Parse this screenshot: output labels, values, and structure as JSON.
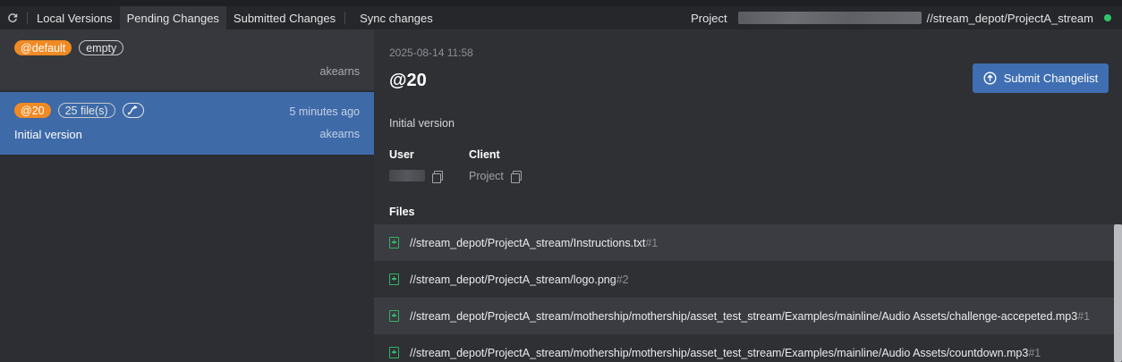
{
  "tabs": {
    "local": "Local Versions",
    "pending": "Pending Changes",
    "submitted": "Submitted Changes",
    "sync": "Sync changes"
  },
  "header": {
    "project_label": "Project",
    "stream": "//stream_depot/ProjectA_stream",
    "status_color": "#30c46b"
  },
  "changelists": [
    {
      "badge": "@default",
      "count_badge": "empty",
      "user": "akearns"
    },
    {
      "badge": "@20",
      "count_badge": "25 file(s)",
      "time": "5 minutes ago",
      "description": "Initial version",
      "user": "akearns",
      "selected": true
    }
  ],
  "detail": {
    "date": "2025-08-14 11:58",
    "title": "@20",
    "submit_label": "Submit Changelist",
    "description": "Initial version",
    "user_header": "User",
    "client_header": "Client",
    "client_value": "Project",
    "files_header": "Files",
    "files": [
      {
        "path": "//stream_depot/ProjectA_stream/Instructions.txt",
        "rev": "#1"
      },
      {
        "path": "//stream_depot/ProjectA_stream/logo.png",
        "rev": "#2"
      },
      {
        "path": "//stream_depot/ProjectA_stream/mothership/mothership/asset_test_stream/Examples/mainline/Audio Assets/challenge-accepeted.mp3",
        "rev": "#1"
      },
      {
        "path": "//stream_depot/ProjectA_stream/mothership/mothership/asset_test_stream/Examples/mainline/Audio Assets/countdown.mp3",
        "rev": "#1"
      }
    ]
  },
  "colors": {
    "accent": "#3f6eb2",
    "badge_orange": "#f08a24",
    "file_add": "#34b267"
  }
}
